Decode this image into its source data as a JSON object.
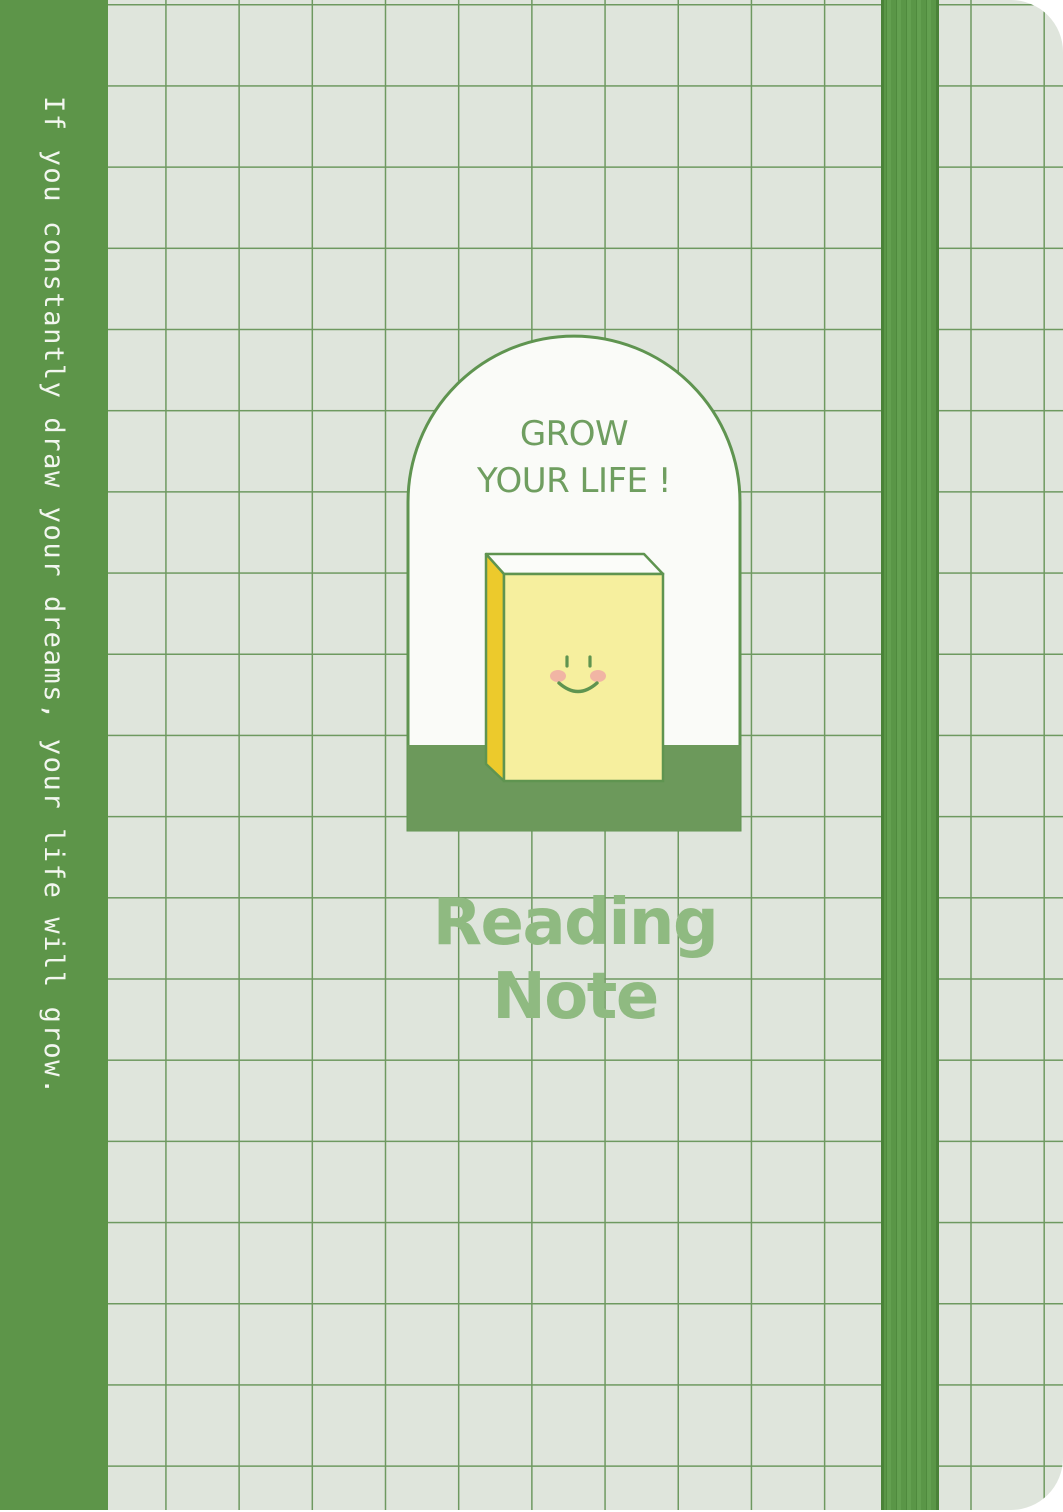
{
  "cover": {
    "spine_quote": "If you constantly draw your dreams, your life will grow.",
    "badge_line_1": "GROW",
    "badge_line_2": "YOUR LIFE !",
    "title": "Reading Note",
    "illustration": "smiling-book-icon"
  },
  "colors": {
    "spine_green": "#5d9549",
    "grid_line": "#6e9960",
    "paper": "#dfe5dc",
    "title_green": "#8fba81",
    "book_yellow": "#f6ef9e",
    "book_spine_yellow": "#ecca2c"
  }
}
